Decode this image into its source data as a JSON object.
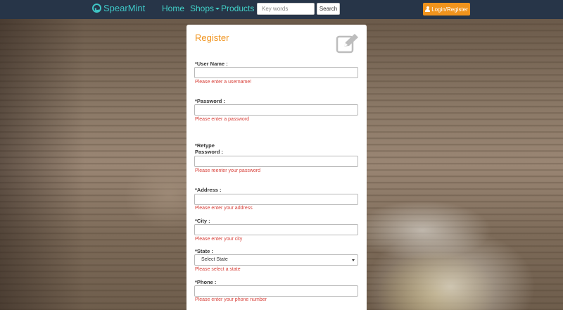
{
  "navbar": {
    "brand": "SpearMint",
    "links": [
      {
        "label": "Home"
      },
      {
        "label": "Shops"
      },
      {
        "label": "Products"
      }
    ],
    "search": {
      "placeholder": "Key words",
      "value": "",
      "button_label": "Search"
    },
    "login_label": "Login/Register"
  },
  "register": {
    "title": "Register",
    "fields": {
      "username": {
        "label": "*User Name :",
        "value": "",
        "error": "Please enter a username!"
      },
      "password": {
        "label": "*Password :",
        "value": "",
        "error": "Please enter a password"
      },
      "retype": {
        "label_line1": "*Retype",
        "label_line2": "Password :",
        "value": "",
        "error": "Please reenter your password"
      },
      "address": {
        "label": "*Address :",
        "value": "",
        "error": "Please enter your address"
      },
      "city": {
        "label": "*City :",
        "value": "",
        "error": "Please enter your city"
      },
      "state": {
        "label": "*State :",
        "selected": "Select State",
        "error": "Please select a state"
      },
      "phone": {
        "label": "*Phone :",
        "value": "",
        "error": "Please enter your phone number"
      }
    }
  },
  "colors": {
    "navbar_bg": "#273548",
    "brand": "#3fc5c5",
    "nav_link": "#42d2c9",
    "accent_orange": "#f0931c",
    "error_red": "#d8423b"
  },
  "icons": {
    "brand": "spearmint-logo-icon",
    "shops_dropdown": "caret-down-icon",
    "login": "user-icon",
    "register_header": "edit-icon",
    "state_select": "chevron-down-icon"
  }
}
